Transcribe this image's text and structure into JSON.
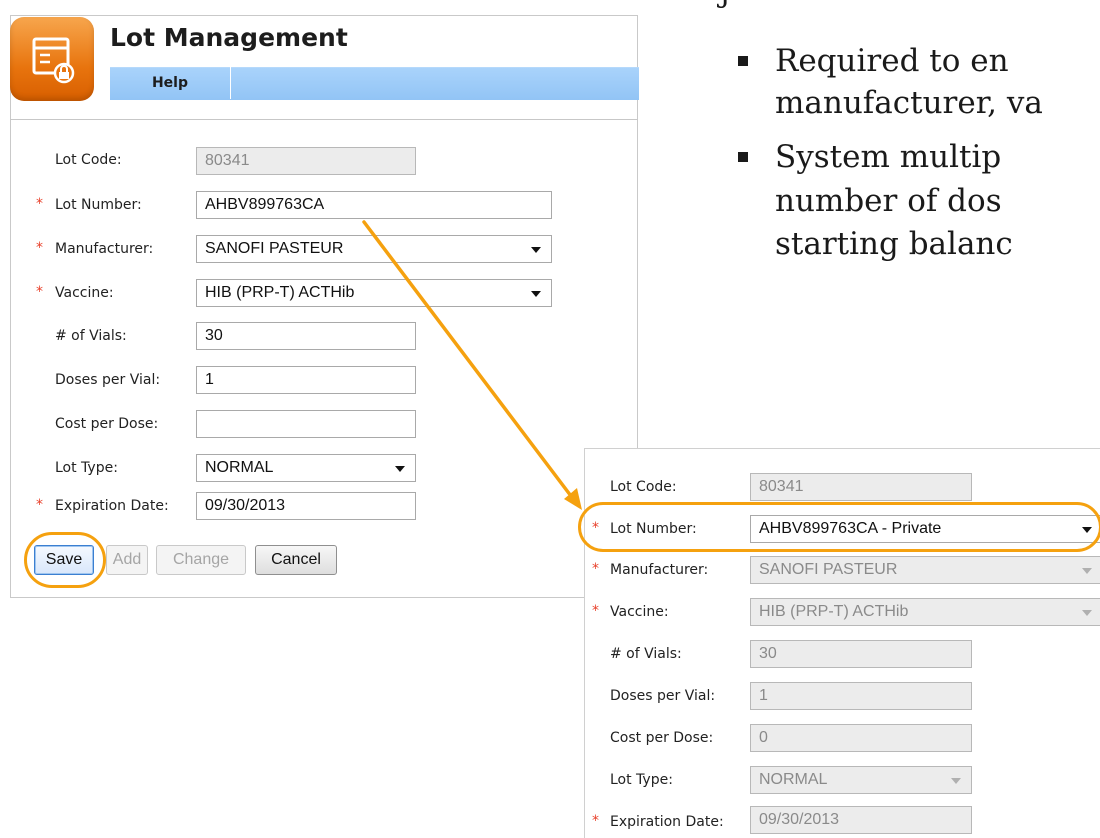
{
  "slide": {
    "bullets": [
      {
        "line1": "Required to en",
        "line2": "manufacturer, va"
      },
      {
        "line1": "System multip",
        "line2": "number of dos",
        "line3": "starting balanc"
      }
    ],
    "top_fragment": "j"
  },
  "window": {
    "title": "Lot Management",
    "menu": {
      "help": "Help"
    },
    "form": {
      "lot_code": {
        "label": "Lot Code:",
        "value": "80341"
      },
      "lot_number": {
        "label": "Lot Number:",
        "value": "AHBV899763CA"
      },
      "manufacturer": {
        "label": "Manufacturer:",
        "value": "SANOFI PASTEUR"
      },
      "vaccine": {
        "label": "Vaccine:",
        "value": "HIB (PRP-T) ACTHib"
      },
      "vials": {
        "label": "# of Vials:",
        "value": "30"
      },
      "doses_per_vial": {
        "label": "Doses per Vial:",
        "value": "1"
      },
      "cost_per_dose": {
        "label": "Cost per Dose:",
        "value": ""
      },
      "lot_type": {
        "label": "Lot Type:",
        "value": "NORMAL"
      },
      "expiration_date": {
        "label": "Expiration Date:",
        "value": "09/30/2013"
      }
    },
    "buttons": {
      "save": "Save",
      "add": "Add",
      "change": "Change",
      "cancel": "Cancel"
    }
  },
  "detail": {
    "lot_code": {
      "label": "Lot Code:",
      "value": "80341"
    },
    "lot_number": {
      "label": "Lot Number:",
      "value": "AHBV899763CA - Private"
    },
    "manufacturer": {
      "label": "Manufacturer:",
      "value": "SANOFI PASTEUR"
    },
    "vaccine": {
      "label": "Vaccine:",
      "value": "HIB (PRP-T) ACTHib"
    },
    "vials": {
      "label": "# of Vials:",
      "value": "30"
    },
    "doses_per_vial": {
      "label": "Doses per Vial:",
      "value": "1"
    },
    "cost_per_dose": {
      "label": "Cost per Dose:",
      "value": "0"
    },
    "lot_type": {
      "label": "Lot Type:",
      "value": "NORMAL"
    },
    "expiration_date": {
      "label": "Expiration Date:",
      "value": "09/30/2013"
    }
  },
  "required_marker": "*",
  "colors": {
    "accent_orange": "#f5a10f",
    "menubar_blue": "#9ccbf8",
    "required_red": "#e8402a"
  }
}
